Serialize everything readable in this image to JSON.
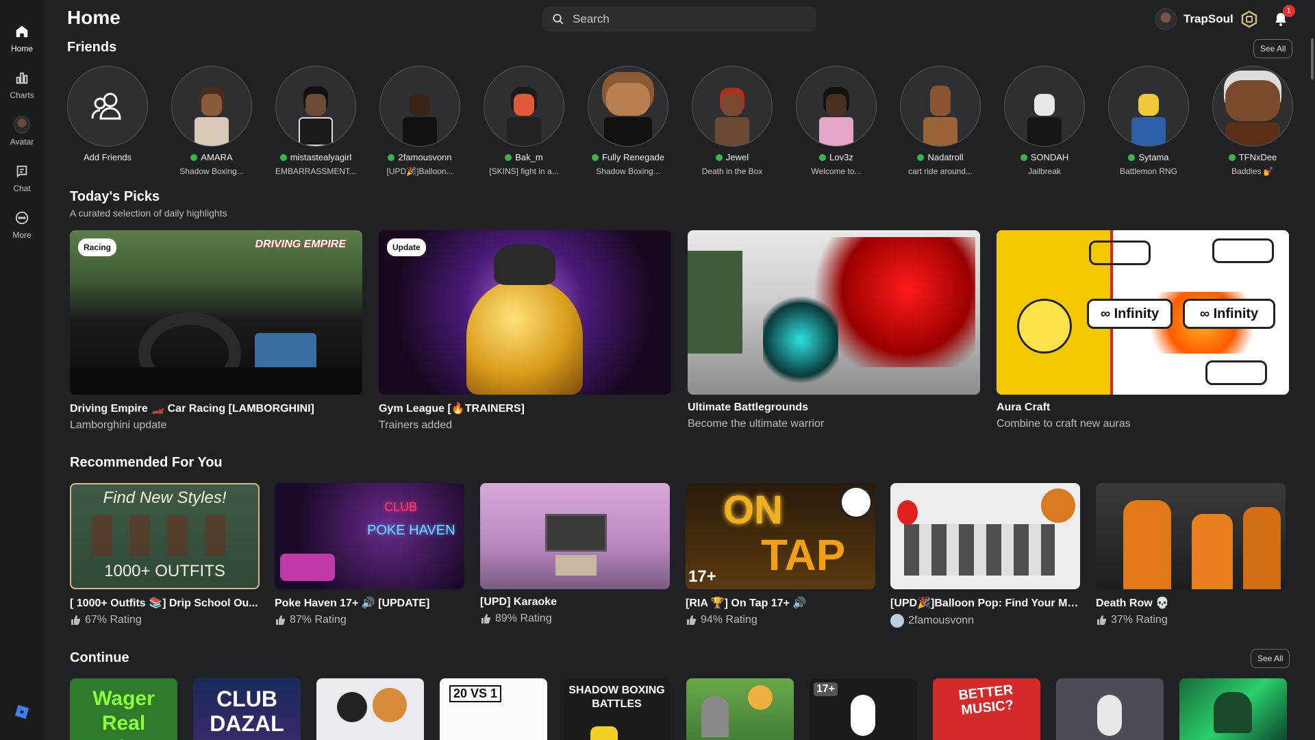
{
  "sidebar": {
    "items": [
      {
        "label": "Home",
        "icon": "home-icon",
        "active": true
      },
      {
        "label": "Charts",
        "icon": "charts-icon"
      },
      {
        "label": "Avatar",
        "icon": "avatar-icon"
      },
      {
        "label": "Chat",
        "icon": "chat-icon"
      },
      {
        "label": "More",
        "icon": "more-icon"
      }
    ]
  },
  "header": {
    "title": "Home",
    "search_placeholder": "Search",
    "username": "TrapSoul",
    "notification_count": "1"
  },
  "friends": {
    "title": "Friends",
    "see_all": "See All",
    "add_friends": "Add Friends",
    "list": [
      {
        "name": "AMARA",
        "game": "Shadow Boxing..."
      },
      {
        "name": "mistastealyagirl",
        "game": "EMBARRASSMENT..."
      },
      {
        "name": "2famousvonn",
        "game": "[UPD🎉]Balloon..."
      },
      {
        "name": "Bak_m",
        "game": "[SKINS] fight in a..."
      },
      {
        "name": "Fully Renegade",
        "game": "Shadow Boxing..."
      },
      {
        "name": "Jewel",
        "game": "Death in the Box"
      },
      {
        "name": "Lov3z",
        "game": "Welcome to..."
      },
      {
        "name": "Nadatroll",
        "game": "cart ride around..."
      },
      {
        "name": "SONDAH",
        "game": "Jailbreak"
      },
      {
        "name": "Sytama",
        "game": "Battlemon RNG"
      },
      {
        "name": "TFNxDee",
        "game": "Baddies 💅"
      }
    ]
  },
  "todays_picks": {
    "title": "Today's Picks",
    "subtitle": "A curated selection of daily highlights",
    "items": [
      {
        "tag": "Racing",
        "title": "Driving Empire 🏎️ Car Racing [LAMBORGHINI]",
        "subtitle": "Lamborghini update",
        "art_text": "DRIVING EMPIRE"
      },
      {
        "tag": "Update",
        "title": "Gym League [🔥TRAINERS]",
        "subtitle": "Trainers added"
      },
      {
        "tag": "",
        "title": "Ultimate Battlegrounds",
        "subtitle": "Become the ultimate warrior"
      },
      {
        "tag": "",
        "title": "Aura Craft",
        "subtitle": "Combine to craft new auras",
        "art_text_a": "∞ Infinity",
        "art_text_b": "∞ Infinity"
      }
    ]
  },
  "recommended": {
    "title": "Recommended For You",
    "items": [
      {
        "title": "[ 1000+ Outfits 📚] Drip School Ou...",
        "meta": "67% Rating",
        "meta_type": "rating",
        "art_text_a": "Find New Styles!",
        "art_text_b": "1000+ OUTFITS"
      },
      {
        "title": "Poke Haven 17+ 🔊 [UPDATE]",
        "meta": "87% Rating",
        "meta_type": "rating",
        "art_text_a": "CLUB",
        "art_text_b": "POKE HAVEN"
      },
      {
        "title": "[UPD] Karaoke",
        "meta": "89% Rating",
        "meta_type": "rating"
      },
      {
        "title": "[RIA 🏆] On Tap 17+ 🔊",
        "meta": "94% Rating",
        "meta_type": "rating",
        "art_text_a": "ON",
        "art_text_b": "TAP",
        "art_text_c": "17+"
      },
      {
        "title": "[UPD🎉]Balloon Pop: Find Your Ma...",
        "meta": "2famousvonn",
        "meta_type": "friend"
      },
      {
        "title": "Death Row 💀",
        "meta": "37% Rating",
        "meta_type": "rating"
      }
    ]
  },
  "continue": {
    "title": "Continue",
    "see_all": "See All",
    "items": [
      {
        "text": "Wager Real Robux"
      },
      {
        "text": "CLUB DAZAL"
      },
      {
        "text": ""
      },
      {
        "text": "20 VS 1"
      },
      {
        "text": "SHADOW BOXING BATTLES"
      },
      {
        "text": ""
      },
      {
        "text": "17+"
      },
      {
        "text": "BETTER MUSIC?"
      },
      {
        "text": ""
      },
      {
        "text": ""
      }
    ]
  },
  "colors": {
    "background": "#1f2124",
    "sidebar": "#191b1d",
    "online": "#39b54a",
    "badge": "#e5312e",
    "logo": "#3b82f6"
  }
}
